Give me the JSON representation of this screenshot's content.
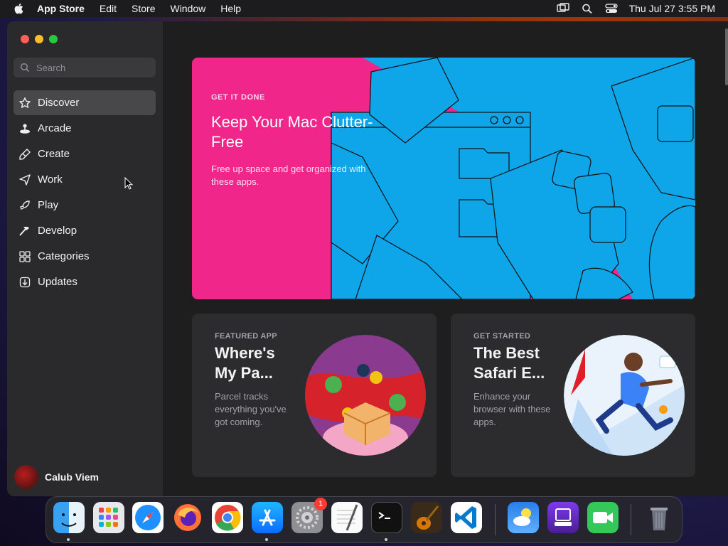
{
  "menubar": {
    "app_name": "App Store",
    "items": [
      "Edit",
      "Store",
      "Window",
      "Help"
    ],
    "clock": "Thu Jul 27  3:55 PM"
  },
  "sidebar": {
    "search_placeholder": "Search",
    "items": [
      {
        "label": "Discover",
        "icon": "star-icon",
        "active": true
      },
      {
        "label": "Arcade",
        "icon": "joystick-icon",
        "active": false
      },
      {
        "label": "Create",
        "icon": "brush-icon",
        "active": false
      },
      {
        "label": "Work",
        "icon": "paper-plane-icon",
        "active": false
      },
      {
        "label": "Play",
        "icon": "rocket-icon",
        "active": false
      },
      {
        "label": "Develop",
        "icon": "hammer-icon",
        "active": false
      },
      {
        "label": "Categories",
        "icon": "grid-icon",
        "active": false
      },
      {
        "label": "Updates",
        "icon": "download-icon",
        "active": false
      }
    ],
    "user_name": "Calub Viem"
  },
  "hero": {
    "eyebrow": "GET IT DONE",
    "title": "Keep Your Mac Clutter-Free",
    "description": "Free up space and get organized with these apps."
  },
  "cards": [
    {
      "eyebrow": "FEATURED APP",
      "title": "Where's My Pa...",
      "description": "Parcel tracks everything you've got coming."
    },
    {
      "eyebrow": "GET STARTED",
      "title": "The Best Safari E...",
      "description": "Enhance your browser with these apps."
    }
  ],
  "dock": {
    "apps": [
      "Finder",
      "Launchpad",
      "Safari",
      "Firefox",
      "Chrome",
      "App Store",
      "System Settings",
      "TextEdit",
      "Terminal",
      "GarageBand",
      "VS Code",
      "Weather",
      "Apple Configurator",
      "FaceTime",
      "Trash"
    ],
    "settings_badge": "1"
  },
  "colors": {
    "accent_pink": "#f0268a",
    "accent_blue": "#0ea5e9",
    "sidebar": "#2a2a2c",
    "content": "#1e1e1e"
  }
}
